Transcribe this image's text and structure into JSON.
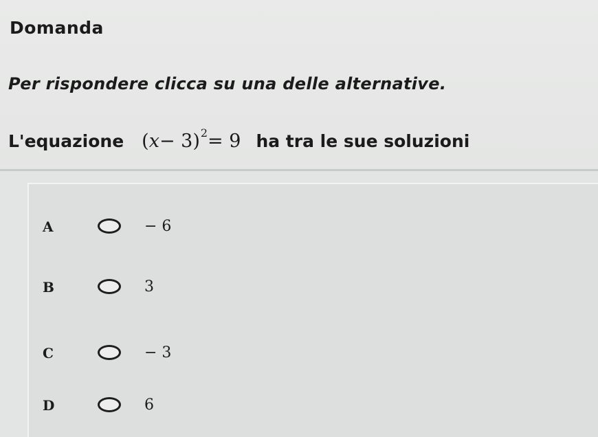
{
  "question": {
    "heading": "Domanda",
    "instruction": "Per rispondere clicca su una delle alternative.",
    "prompt_before": "L'equazione",
    "equation": {
      "open": "(",
      "variable": "x",
      "operator": " − 3)",
      "exponent": "2",
      "rhs": " = 9"
    },
    "prompt_after": "ha tra le sue soluzioni"
  },
  "options": [
    {
      "letter": "A",
      "value": "− 6"
    },
    {
      "letter": "B",
      "value": "3"
    },
    {
      "letter": "C",
      "value": "− 3"
    },
    {
      "letter": "D",
      "value": "6"
    }
  ]
}
